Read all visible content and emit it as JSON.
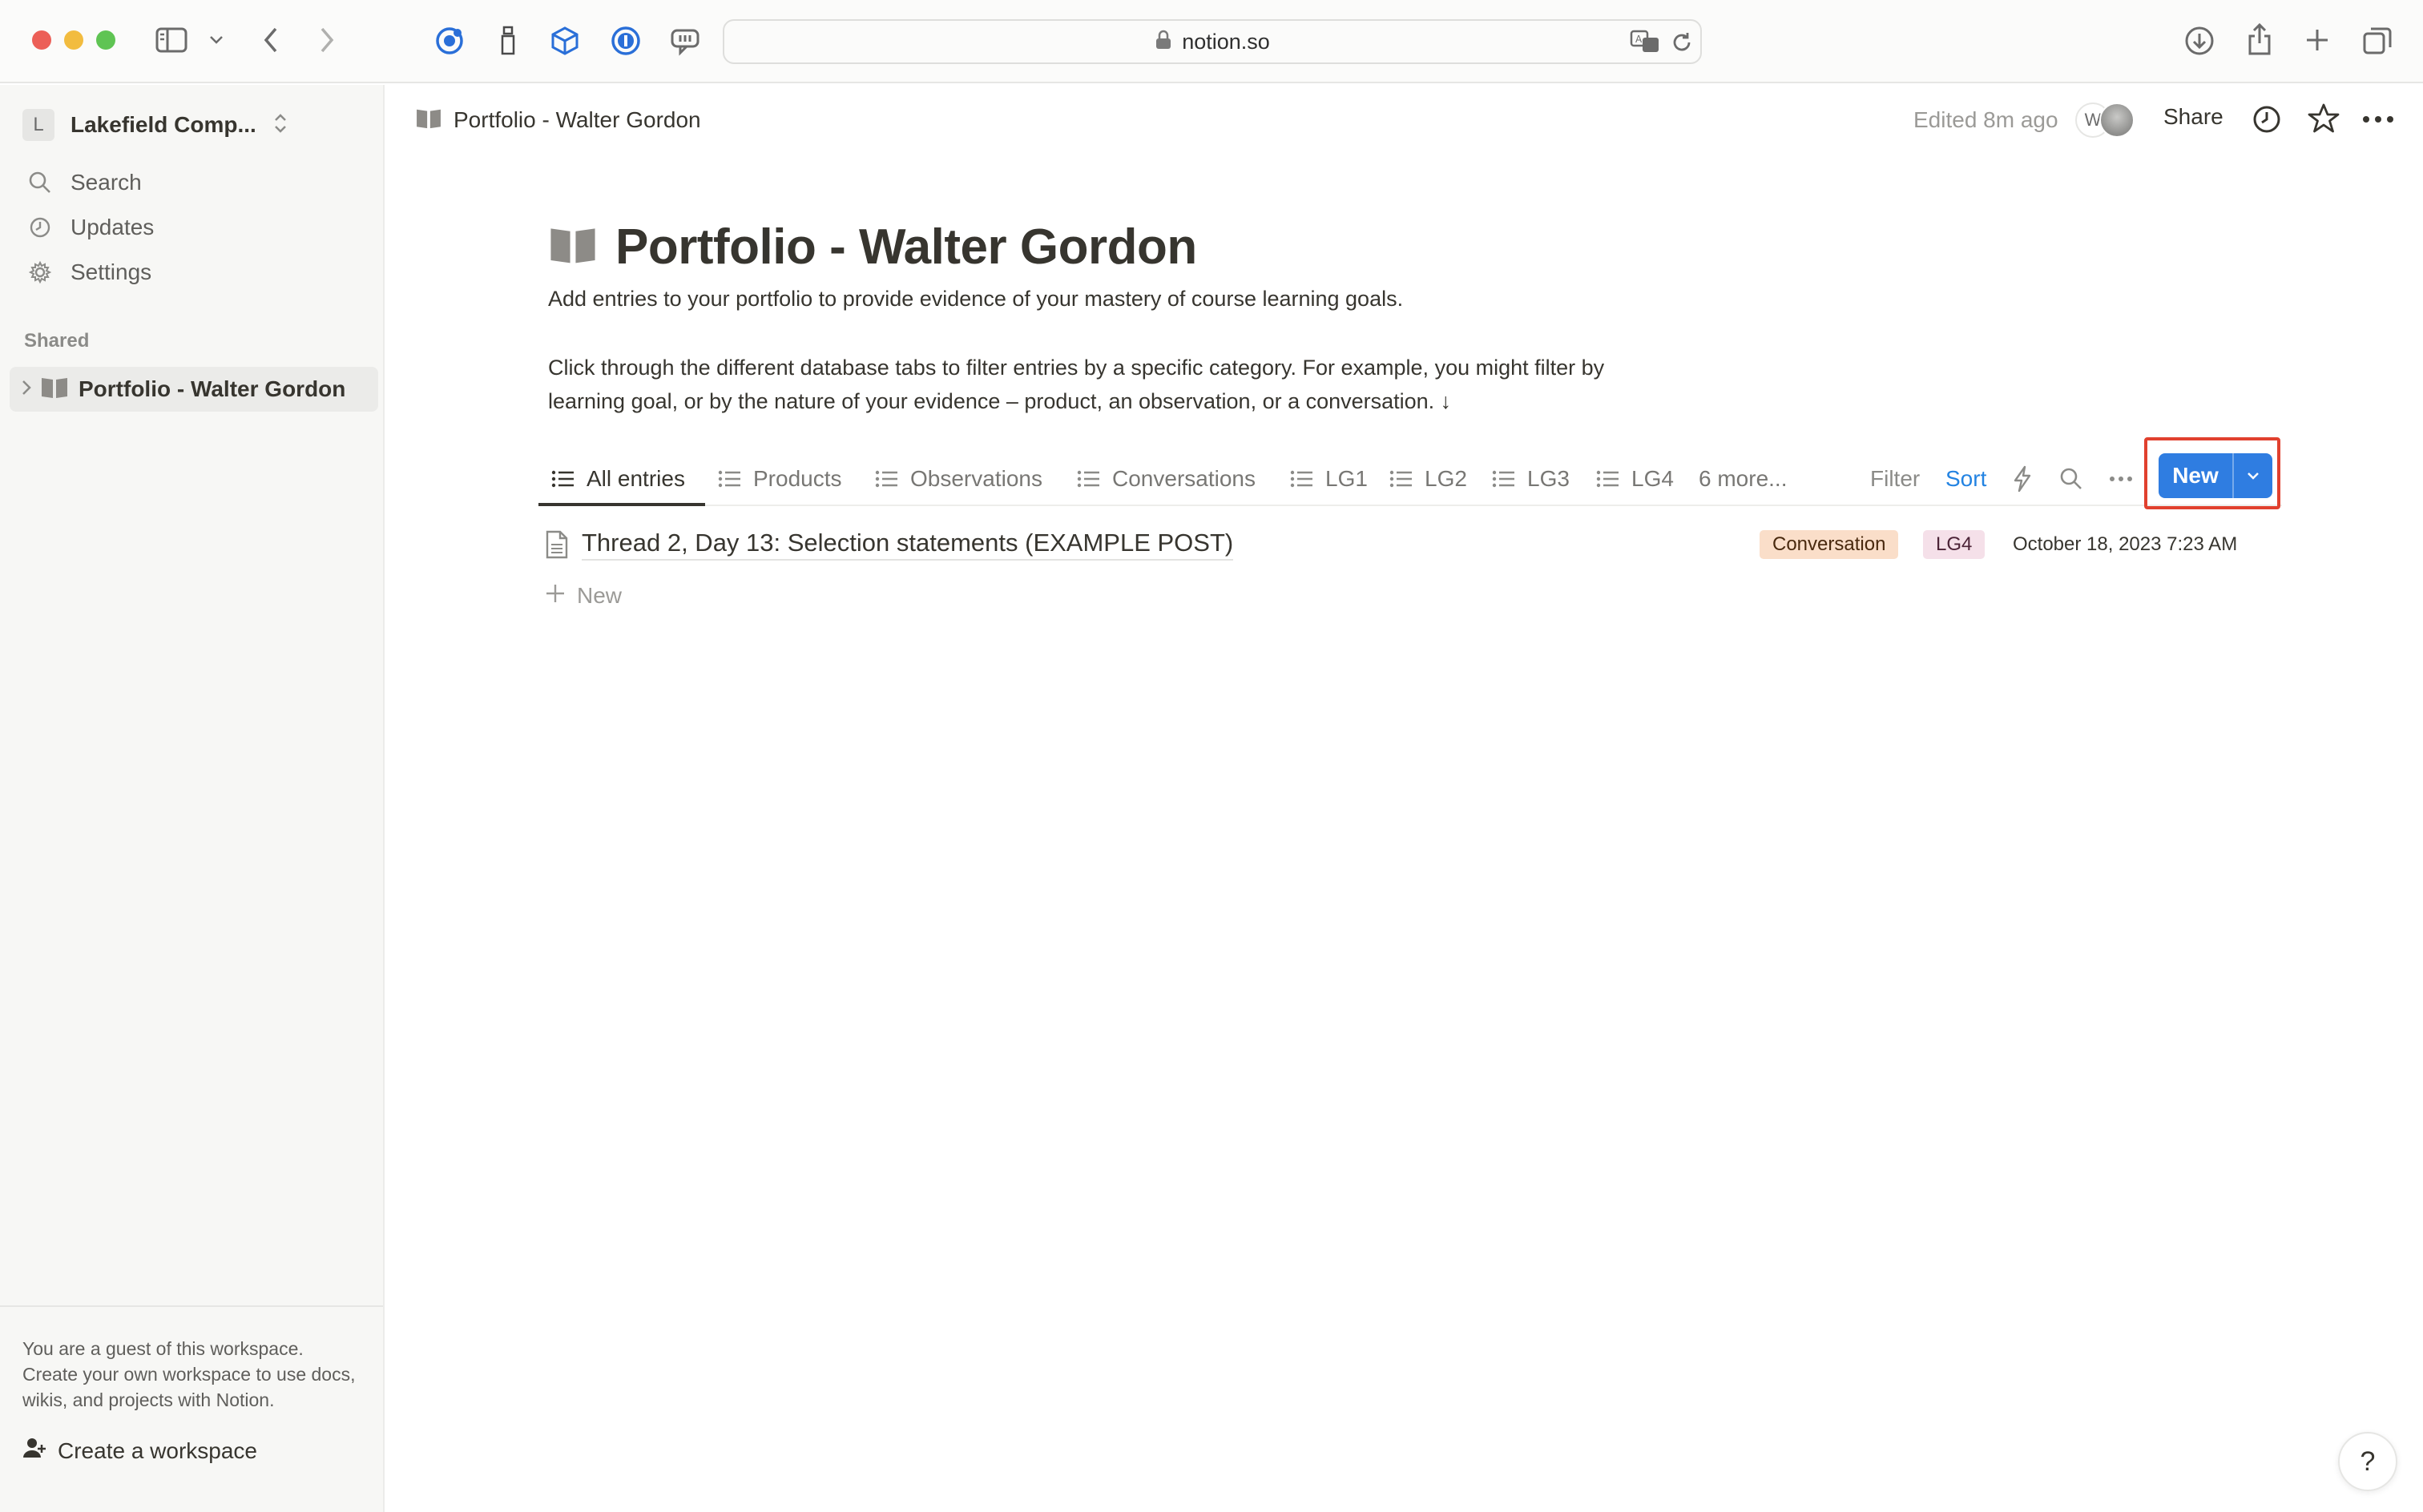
{
  "browser": {
    "url": "notion.so"
  },
  "sidebar": {
    "workspace_initial": "L",
    "workspace_name": "Lakefield Comp...",
    "items": [
      {
        "label": "Search",
        "icon": "search-icon"
      },
      {
        "label": "Updates",
        "icon": "clock-icon"
      },
      {
        "label": "Settings",
        "icon": "gear-icon"
      }
    ],
    "section_label": "Shared",
    "shared_page": {
      "label": "Portfolio - Walter Gordon",
      "icon": "book-icon"
    },
    "guest_notice": "You are a guest of this workspace. Create your own workspace to use docs, wikis, and projects with Notion.",
    "create_workspace_label": "Create a workspace"
  },
  "topbar": {
    "breadcrumb": "Portfolio - Walter Gordon",
    "edited": "Edited 8m ago",
    "avatar_initial": "W",
    "share_label": "Share"
  },
  "page": {
    "title": "Portfolio - Walter Gordon",
    "description_1": "Add entries to your portfolio to provide evidence of your mastery of course learning goals.",
    "description_2": "Click through the different database tabs to filter entries by a specific category. For example, you might filter by",
    "description_3": "learning goal, or by the nature of your evidence – product, an observation, or a conversation. ↓"
  },
  "database": {
    "tabs": [
      {
        "label": "All entries",
        "active": true
      },
      {
        "label": "Products",
        "active": false
      },
      {
        "label": "Observations",
        "active": false
      },
      {
        "label": "Conversations",
        "active": false
      },
      {
        "label": "LG1",
        "active": false
      },
      {
        "label": "LG2",
        "active": false
      },
      {
        "label": "LG3",
        "active": false
      },
      {
        "label": "LG4",
        "active": false
      }
    ],
    "more_tabs": "6 more...",
    "filter_label": "Filter",
    "sort_label": "Sort",
    "new_label": "New",
    "rows": [
      {
        "title": "Thread 2, Day 13: Selection statements (EXAMPLE POST)",
        "tags": [
          "Conversation",
          "LG4"
        ],
        "date": "October 18, 2023 7:23 AM"
      }
    ],
    "add_new_label": "New"
  },
  "help_label": "?",
  "colors": {
    "accent_blue": "#2f7de1",
    "highlight_red": "#e1402e",
    "tag_conversation": "#fadec9",
    "tag_lg4": "#f5e0e9"
  }
}
